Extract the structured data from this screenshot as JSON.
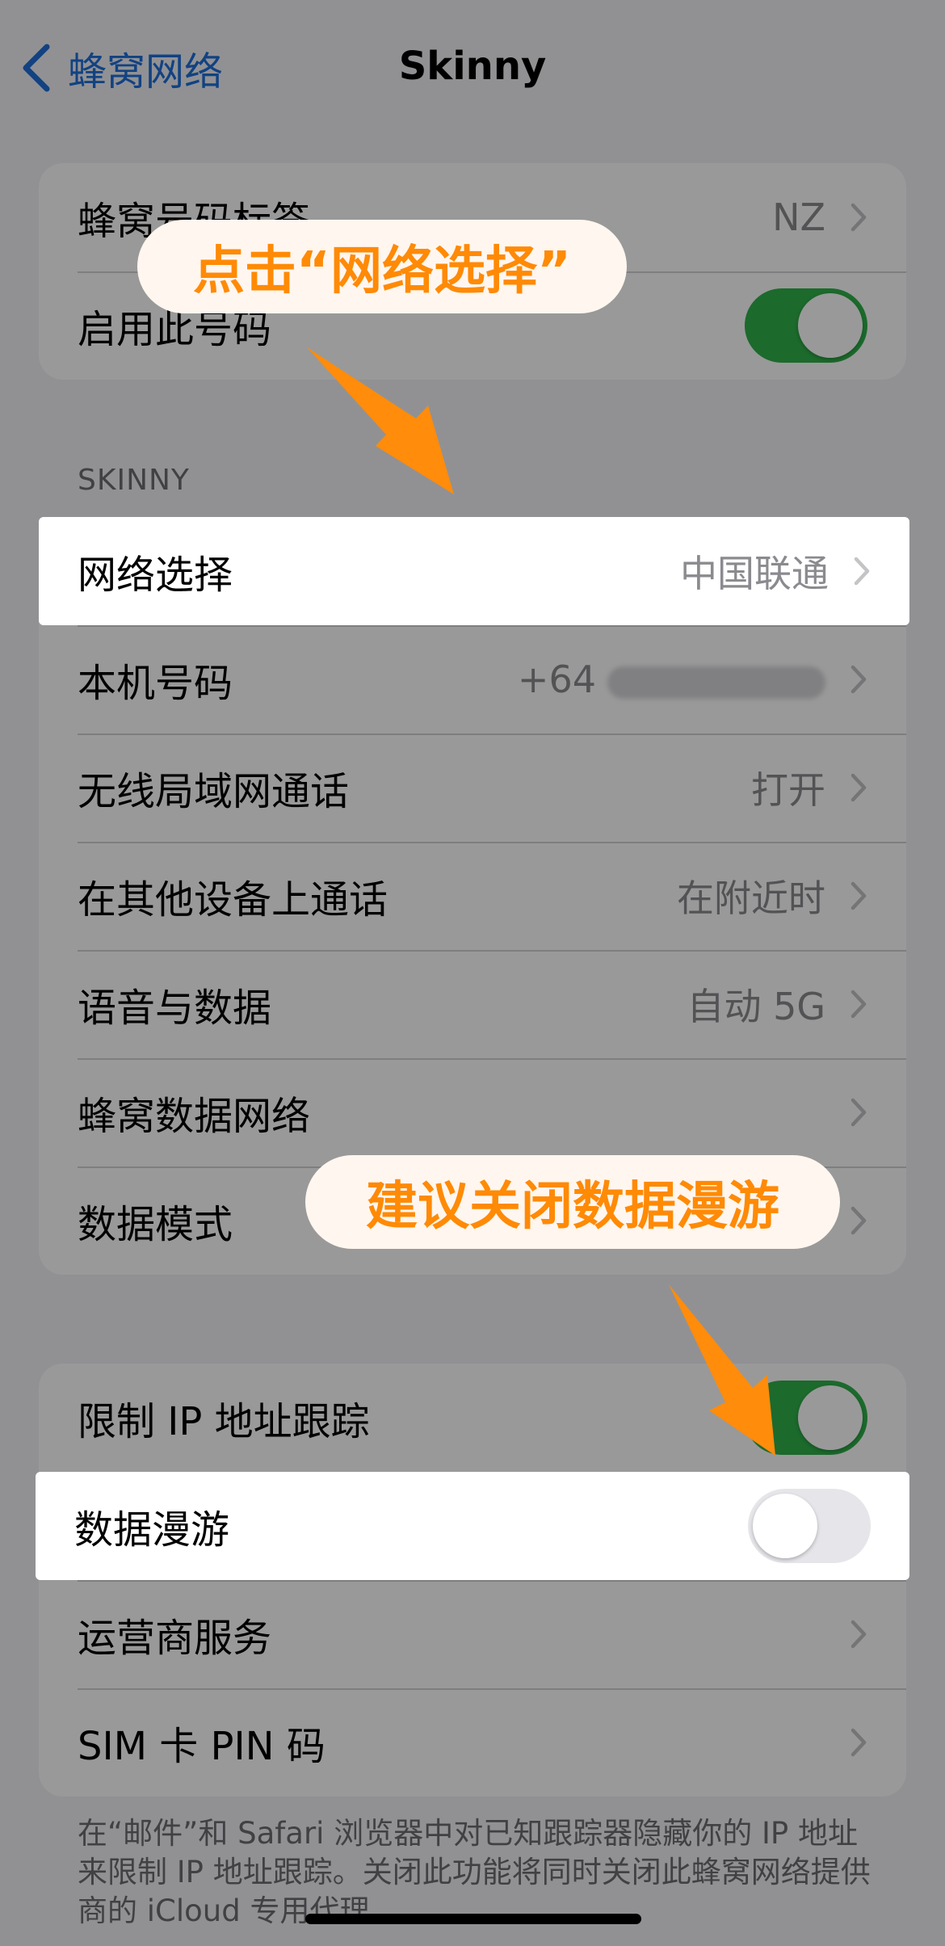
{
  "nav": {
    "back_label": "蜂窝网络",
    "title": "Skinny"
  },
  "group1": {
    "label_row": {
      "label": "蜂窝号码标签",
      "value": "NZ"
    },
    "enable_row": {
      "label": "启用此号码",
      "state": "on"
    }
  },
  "section_header": "SKINNY",
  "group2": {
    "network_selection": {
      "label": "网络选择",
      "value": "中国联通"
    },
    "my_number": {
      "label": "本机号码",
      "value": "+64"
    },
    "wifi_calling": {
      "label": "无线局域网通话",
      "value": "打开"
    },
    "other_devices": {
      "label": "在其他设备上通话",
      "value": "在附近时"
    },
    "voice_data": {
      "label": "语音与数据",
      "value": "自动 5G"
    },
    "cellular_network": {
      "label": "蜂窝数据网络"
    },
    "data_mode": {
      "label": "数据模式"
    }
  },
  "group3": {
    "limit_ip": {
      "label": "限制 IP 地址跟踪",
      "state": "on"
    },
    "data_roaming": {
      "label": "数据漫游",
      "state": "off"
    },
    "carrier_services": {
      "label": "运营商服务"
    },
    "sim_pin": {
      "label": "SIM 卡 PIN 码"
    }
  },
  "footer_note": "在“邮件”和 Safari 浏览器中对已知跟踪器隐藏你的 IP 地址来限制 IP 地址跟踪。关闭此功能将同时关闭此蜂窝网络提供商的 iCloud 专用代理。",
  "annotations": {
    "callout_network": "点击“网络选择”",
    "callout_roaming": "建议关闭数据漫游"
  },
  "colors": {
    "ios_blue": "#1e6fd9",
    "toggle_green": "#2fb14a",
    "callout_orange": "#ff8a05",
    "callout_bg": "#fff6ef"
  }
}
